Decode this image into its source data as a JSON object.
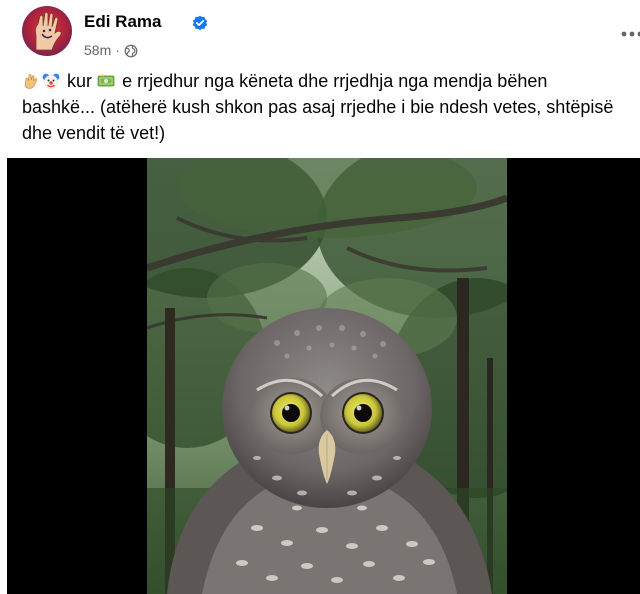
{
  "post": {
    "author": "Edi Rama",
    "timestamp": "58m",
    "separator": "·",
    "audience_icon": "globe-icon",
    "verified_icon": "verified-badge-icon",
    "more_icon": "more-options-icon",
    "caption_emojis": [
      "hand-emoji",
      "clown-face-emoji",
      "money-emoji"
    ],
    "caption_part1": "kur",
    "caption_part2": "e rrjedhur nga këneta dhe rrjedhja nga mendja bëhen bashkë... (atëherë kush shkon pas asaj rrjedhe i bie ndesh vetes, shtëpisë dhe vendit të vet!)"
  },
  "colors": {
    "verified_blue": "#1877f2",
    "meta_gray": "#65676b",
    "text": "#050505",
    "media_background": "#000000"
  }
}
